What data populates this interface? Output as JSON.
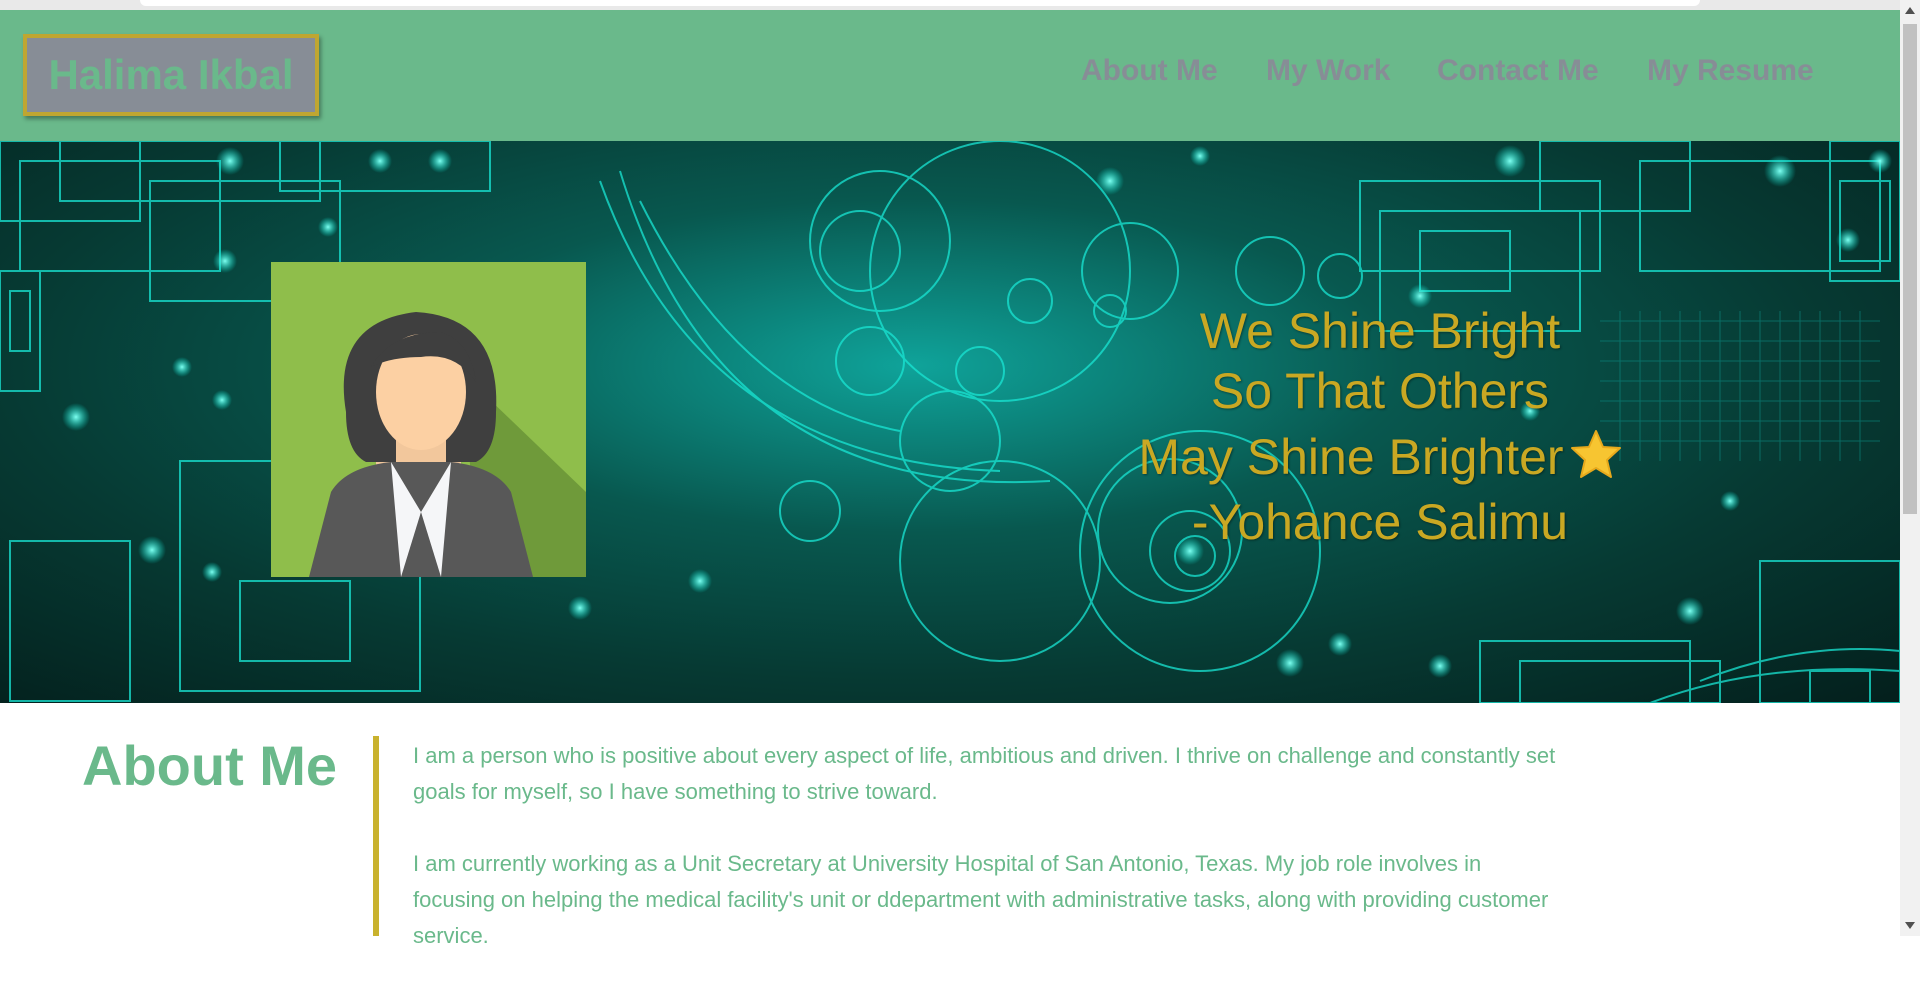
{
  "header": {
    "logo_text": "Halima Ikbal",
    "nav": [
      {
        "label": "About Me"
      },
      {
        "label": "My Work"
      },
      {
        "label": "Contact Me"
      },
      {
        "label": "My Resume"
      }
    ]
  },
  "hero": {
    "quote_lines": [
      "We Shine Bright",
      "So That Others",
      "May Shine Brighter",
      "-Yohance Salimu"
    ],
    "star_icon": "star-icon"
  },
  "about": {
    "title": "About Me",
    "paragraphs": [
      "I am a person who is positive about every aspect of life, ambitious and driven. I thrive on challenge and constantly set goals for myself, so I have something to strive toward.",
      "I am currently working as a Unit Secretary at University Hospital of San Antonio, Texas. My job role involves in focusing on helping the medical facility's unit or ddepartment with administrative tasks, along with providing customer service."
    ]
  },
  "colors": {
    "header_bg": "#6ab98b",
    "logo_bg": "#878d96",
    "accent_gold": "#c9a823",
    "nav_text": "#878d96",
    "about_text": "#6ab98b"
  }
}
